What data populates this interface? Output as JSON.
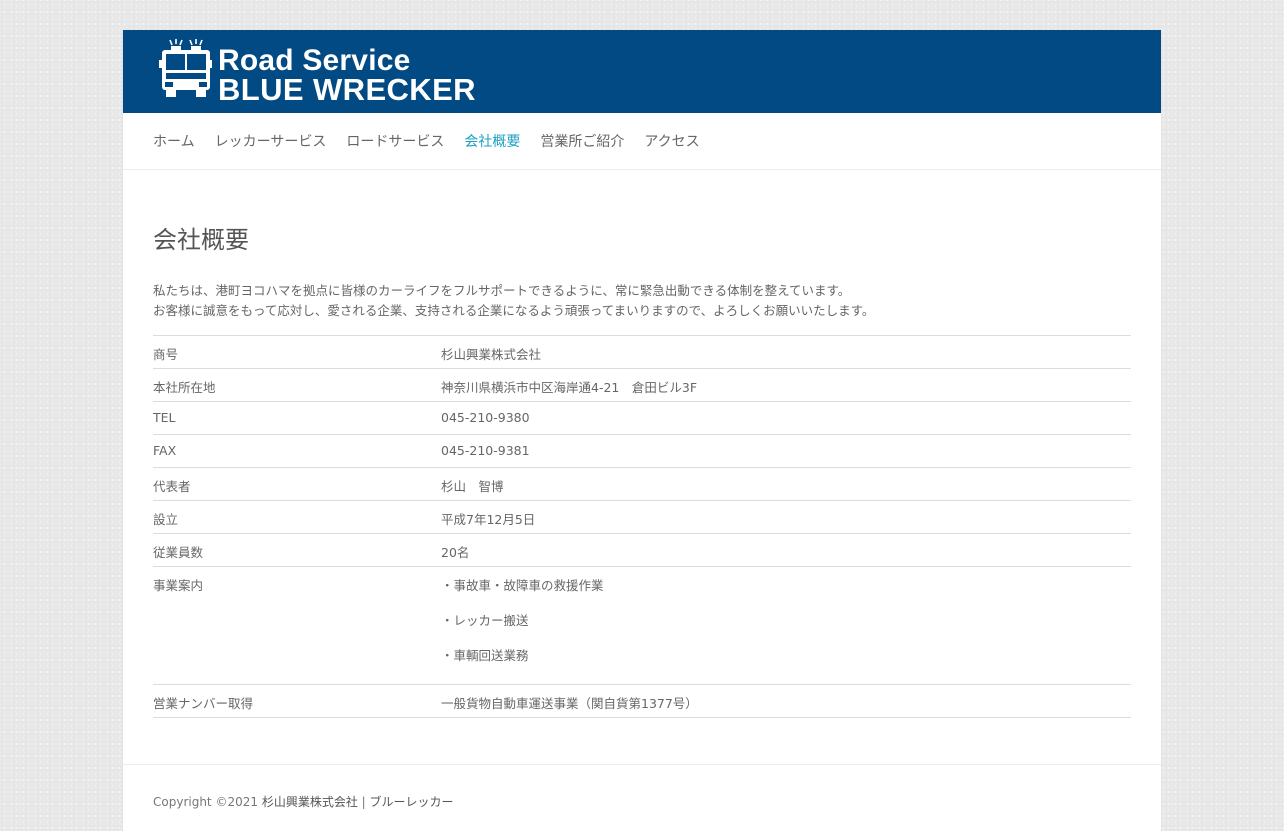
{
  "header": {
    "logo_line1": "Road Service",
    "logo_line2": "BLUE WRECKER",
    "brand_color": "#024a83",
    "logo_icon": "tow-truck-icon"
  },
  "nav": {
    "items": [
      {
        "label": "ホーム",
        "active": false
      },
      {
        "label": "レッカーサービス",
        "active": false
      },
      {
        "label": "ロードサービス",
        "active": false
      },
      {
        "label": "会社概要",
        "active": true
      },
      {
        "label": "営業所ご紹介",
        "active": false
      },
      {
        "label": "アクセス",
        "active": false
      }
    ],
    "active_color": "#1aa0c4"
  },
  "main": {
    "title": "会社概要",
    "intro": [
      "私たちは、港町ヨコハマを拠点に皆様のカーライフをフルサポートできるように、常に緊急出動できる体制を整えています。",
      "お客様に誠意をもって応対し、愛される企業、支持される企業になるよう頑張ってまいりますので、よろしくお願いいたします。"
    ],
    "table": [
      {
        "label": "商号",
        "value": "杉山興業株式会社"
      },
      {
        "label": "本社所在地",
        "value": "神奈川県横浜市中区海岸通4-21　倉田ビル3F"
      },
      {
        "label": "TEL",
        "value": "045-210-9380"
      },
      {
        "label": "FAX",
        "value": "045-210-9381"
      },
      {
        "label": "代表者",
        "value": "杉山　智博"
      },
      {
        "label": "設立",
        "value": "平成7年12月5日"
      },
      {
        "label": "従業員数",
        "value": "20名"
      },
      {
        "label": "事業案内",
        "values": [
          "・事故車・故障車の救援作業",
          "・レッカー搬送",
          "・車輌回送業務"
        ]
      },
      {
        "label": "営業ナンバー取得",
        "value": "一般貨物自動車運送事業（関自貨第1377号）"
      }
    ]
  },
  "footer": {
    "copyright": "Copyright ©2021",
    "company_link": "杉山興業株式会社",
    "separator": "|",
    "site_link": "ブルーレッカー"
  }
}
